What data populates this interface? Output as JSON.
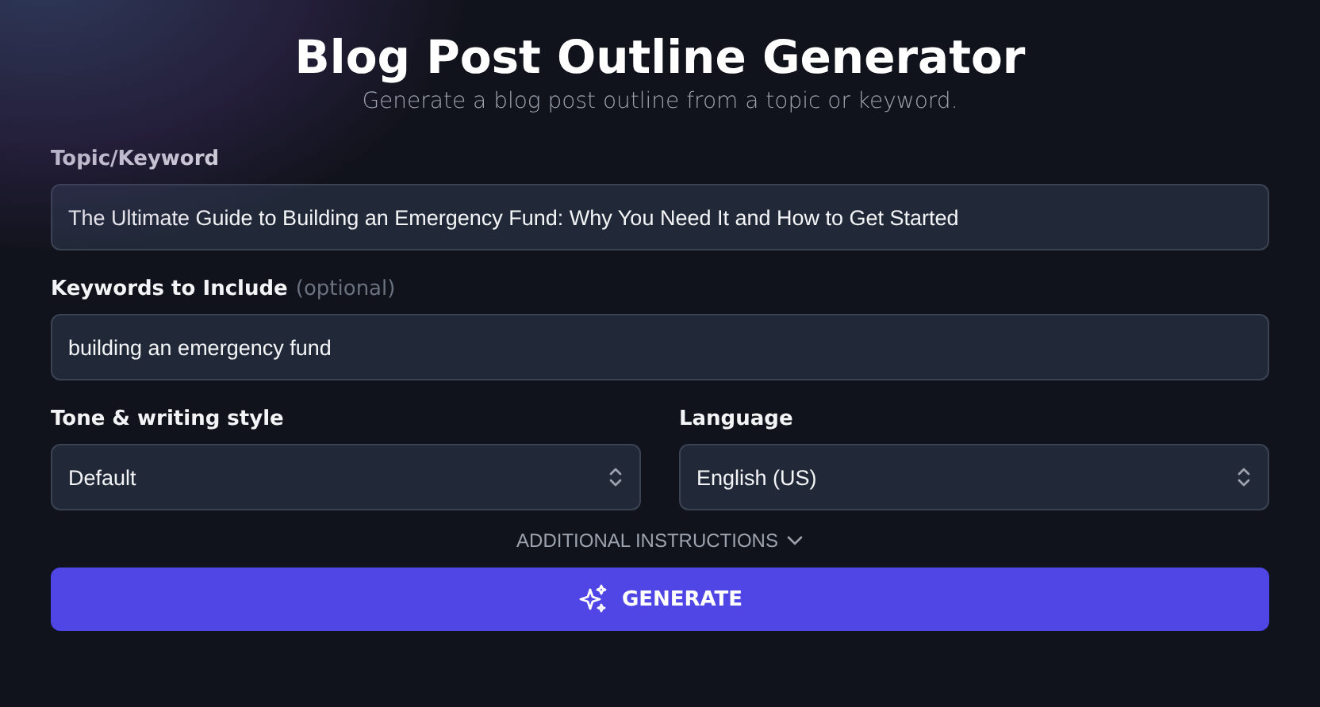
{
  "header": {
    "title": "Blog Post Outline Generator",
    "subtitle": "Generate a blog post outline from a topic or keyword."
  },
  "topic": {
    "label": "Topic/Keyword",
    "value": "The Ultimate Guide to Building an Emergency Fund: Why You Need It and How to Get Started"
  },
  "keywords": {
    "label": "Keywords to Include",
    "hint": "(optional)",
    "value": "building an emergency fund"
  },
  "selects": [
    {
      "label": "Tone & writing style",
      "value": "Default"
    },
    {
      "label": "Language",
      "value": "English (US)"
    }
  ],
  "additional_instructions": {
    "label": "ADDITIONAL INSTRUCTIONS",
    "expanded": false
  },
  "generate_button": {
    "label": "GENERATE"
  }
}
